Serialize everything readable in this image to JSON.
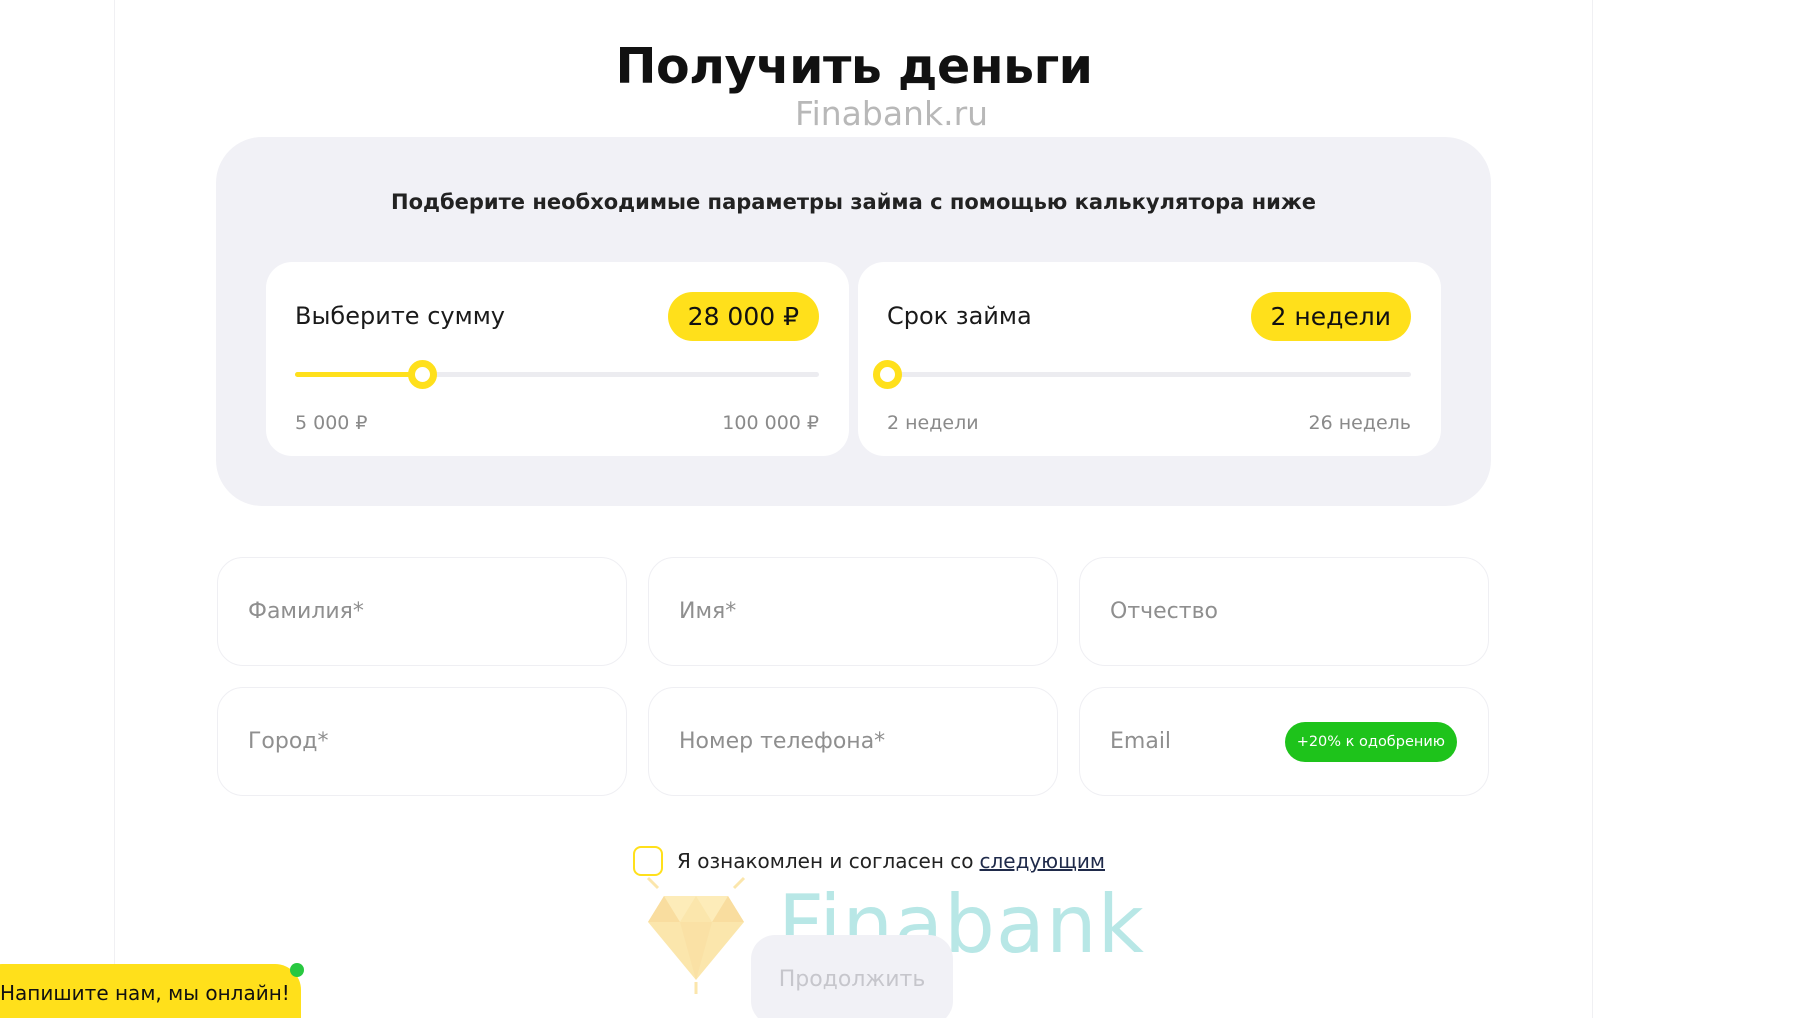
{
  "page": {
    "title": "Получить деньги",
    "watermark_top": "Finabank.ru"
  },
  "calculator": {
    "subtitle": "Подберите необходимые параметры займа с помощью калькулятора ниже",
    "amount": {
      "label": "Выберите сумму",
      "value_text": "28 000 ₽",
      "value": 28000,
      "min_text": "5 000 ₽",
      "min": 5000,
      "max_text": "100 000 ₽",
      "max": 100000
    },
    "term": {
      "label": "Срок займа",
      "value_text": "2 недели",
      "value": 2,
      "min_text": "2 недели",
      "min": 2,
      "max_text": "26 недель",
      "max": 26
    }
  },
  "form": {
    "last_name_placeholder": "Фамилия*",
    "first_name_placeholder": "Имя*",
    "middle_name_placeholder": "Отчество",
    "city_placeholder": "Город*",
    "phone_placeholder": "Номер телефона*",
    "email_placeholder": "Email",
    "email_bonus": "+20% к одобрению"
  },
  "consent": {
    "text": "Я ознакомлен и согласен со",
    "link": "следующим"
  },
  "continue_label": "Продолжить",
  "watermark_bottom": "Finabank",
  "chat": {
    "label": "Напишите нам, мы онлайн!"
  },
  "colors": {
    "accent": "#ffe01b",
    "card_bg": "#f1f1f6",
    "bonus_green": "#1ec31b",
    "online_green": "#28c840"
  },
  "icons": {
    "watermark_logo": "diamond-logo-icon",
    "online_indicator": "online-status-dot"
  }
}
